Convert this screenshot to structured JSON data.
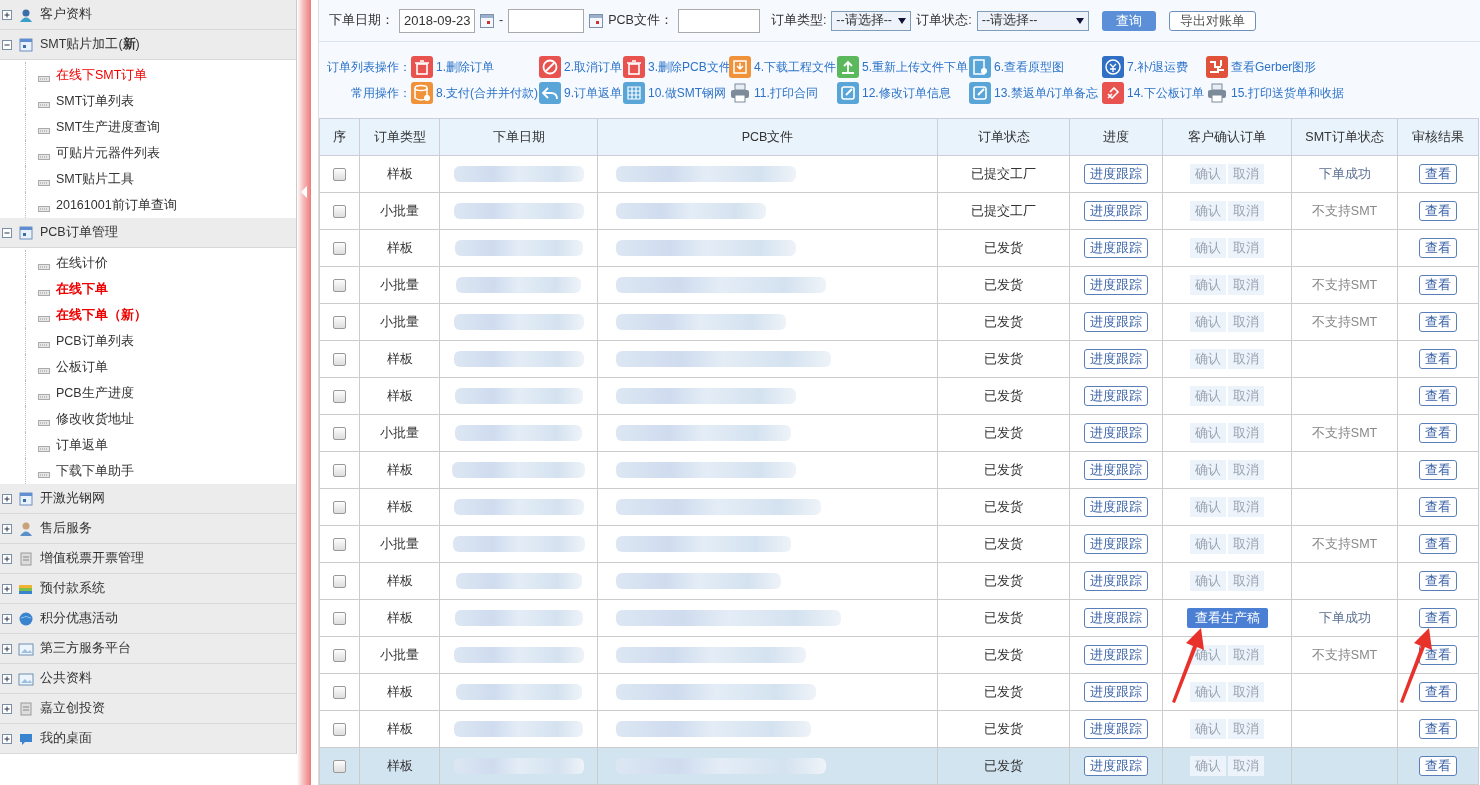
{
  "sidebar": {
    "groups": [
      {
        "title": "客户资料",
        "expanded": false
      },
      {
        "title": "SMT贴片加工(**新**)",
        "expanded": true,
        "children": [
          {
            "label": "在线下SMT订单",
            "highlighted": true,
            "bold": false
          },
          {
            "label": "SMT订单列表"
          },
          {
            "label": "SMT生产进度查询"
          },
          {
            "label": "可贴片元器件列表"
          },
          {
            "label": "SMT贴片工具"
          },
          {
            "label": "20161001前订单查询"
          }
        ]
      },
      {
        "title": "PCB订单管理",
        "expanded": true,
        "children": [
          {
            "label": "在线计价"
          },
          {
            "label": "在线下单",
            "highlighted": true,
            "bold": true
          },
          {
            "label": "在线下单（新）",
            "highlighted": true,
            "bold": true
          },
          {
            "label": "PCB订单列表"
          },
          {
            "label": "公板订单"
          },
          {
            "label": "PCB生产进度"
          },
          {
            "label": "修改收货地址"
          },
          {
            "label": "订单返单"
          },
          {
            "label": "下载下单助手"
          }
        ]
      },
      {
        "title": "开激光钢网",
        "expanded": false
      },
      {
        "title": "售后服务",
        "expanded": false
      },
      {
        "title": "增值税票开票管理",
        "expanded": false
      },
      {
        "title": "预付款系统",
        "expanded": false
      },
      {
        "title": "积分优惠活动",
        "expanded": false
      },
      {
        "title": "第三方服务平台",
        "expanded": false
      },
      {
        "title": "公共资料",
        "expanded": false
      },
      {
        "title": "嘉立创投资",
        "expanded": false
      },
      {
        "title": "我的桌面",
        "expanded": false
      }
    ]
  },
  "filters": {
    "date_label": "下单日期：",
    "date_from": "2018-09-23",
    "date_sep": "-",
    "pcb_label": "PCB文件：",
    "type_label": "订单类型:",
    "type_value": "--请选择--",
    "status_label": "订单状态:",
    "status_value": "--请选择--",
    "query_button": "查询",
    "export_button": "导出对账单"
  },
  "actions": [
    {
      "label": "订单列表操作：",
      "items": [
        {
          "text": "1.删除订单",
          "color": "#e8524f"
        },
        {
          "text": "2.取消订单",
          "color": "#e8524f"
        },
        {
          "text": "3.删除PCB文件",
          "color": "#e8524f"
        },
        {
          "text": "4.下载工程文件",
          "color": "#f0923a"
        },
        {
          "text": "5.重新上传文件下单",
          "color": "#5cb85c"
        },
        {
          "text": "6.查看原型图",
          "color": "#5aa5d8"
        },
        {
          "text": "7.补/退运费",
          "color": "#2f6fc4"
        },
        {
          "text": "查看Gerber图形",
          "color": "#e0533a"
        }
      ]
    },
    {
      "label": "常用操作：",
      "items": [
        {
          "text": "8.支付(合并并付款)",
          "color": "#f0923a"
        },
        {
          "text": "9.订单返单",
          "color": "#5aa5d8"
        },
        {
          "text": "10.做SMT钢网",
          "color": "#5aa5d8"
        },
        {
          "text": "11.打印合同",
          "color": "#7c8a99"
        },
        {
          "text": "12.修改订单信息",
          "color": "#5aa5d8"
        },
        {
          "text": "13.禁返单/订单备忘",
          "color": "#5aa5d8"
        },
        {
          "text": "14.下公板订单",
          "color": "#e8524f"
        },
        {
          "text": "15.打印送货单和收据",
          "color": "#7c8a99"
        }
      ]
    }
  ],
  "table": {
    "columns": [
      "序",
      "订单类型",
      "下单日期",
      "PCB文件",
      "订单状态",
      "进度",
      "客户确认订单",
      "SMT订单状态",
      "审核结果"
    ],
    "annotations": [
      {
        "kind": "arrow"
      },
      {
        "kind": "arrow"
      }
    ],
    "rows": [
      {
        "checked": false,
        "selected": false,
        "type": "样板",
        "status": "已提交工厂",
        "progress": "进度跟踪",
        "confirm": {
          "kind": "pair",
          "ok": "确认",
          "cancel": "取消"
        },
        "smt": "下单成功",
        "smt_success": true,
        "result": "查看"
      },
      {
        "checked": false,
        "selected": false,
        "type": "小批量",
        "status": "已提交工厂",
        "progress": "进度跟踪",
        "confirm": {
          "kind": "pair",
          "ok": "确认",
          "cancel": "取消"
        },
        "smt": "不支持SMT",
        "smt_success": false,
        "result": "查看"
      },
      {
        "checked": false,
        "selected": false,
        "type": "样板",
        "status": "已发货",
        "progress": "进度跟踪",
        "confirm": {
          "kind": "pair",
          "ok": "确认",
          "cancel": "取消"
        },
        "result": "查看"
      },
      {
        "checked": false,
        "selected": false,
        "type": "小批量",
        "status": "已发货",
        "progress": "进度跟踪",
        "confirm": {
          "kind": "pair",
          "ok": "确认",
          "cancel": "取消"
        },
        "smt": "不支持SMT",
        "smt_success": false,
        "result": "查看"
      },
      {
        "checked": false,
        "selected": false,
        "type": "小批量",
        "status": "已发货",
        "progress": "进度跟踪",
        "confirm": {
          "kind": "pair",
          "ok": "确认",
          "cancel": "取消"
        },
        "smt": "不支持SMT",
        "smt_success": false,
        "result": "查看"
      },
      {
        "checked": false,
        "selected": false,
        "type": "样板",
        "status": "已发货",
        "progress": "进度跟踪",
        "confirm": {
          "kind": "pair",
          "ok": "确认",
          "cancel": "取消"
        },
        "result": "查看"
      },
      {
        "checked": false,
        "selected": false,
        "type": "样板",
        "status": "已发货",
        "progress": "进度跟踪",
        "confirm": {
          "kind": "pair",
          "ok": "确认",
          "cancel": "取消"
        },
        "result": "查看"
      },
      {
        "checked": false,
        "selected": false,
        "type": "小批量",
        "status": "已发货",
        "progress": "进度跟踪",
        "confirm": {
          "kind": "pair",
          "ok": "确认",
          "cancel": "取消"
        },
        "smt": "不支持SMT",
        "smt_success": false,
        "result": "查看"
      },
      {
        "checked": false,
        "selected": false,
        "type": "样板",
        "status": "已发货",
        "progress": "进度跟踪",
        "confirm": {
          "kind": "pair",
          "ok": "确认",
          "cancel": "取消"
        },
        "result": "查看"
      },
      {
        "checked": false,
        "selected": false,
        "type": "样板",
        "status": "已发货",
        "progress": "进度跟踪",
        "confirm": {
          "kind": "pair",
          "ok": "确认",
          "cancel": "取消"
        },
        "result": "查看"
      },
      {
        "checked": false,
        "selected": false,
        "type": "小批量",
        "status": "已发货",
        "progress": "进度跟踪",
        "confirm": {
          "kind": "pair",
          "ok": "确认",
          "cancel": "取消"
        },
        "smt": "不支持SMT",
        "smt_success": false,
        "result": "查看"
      },
      {
        "checked": false,
        "selected": false,
        "type": "样板",
        "status": "已发货",
        "progress": "进度跟踪",
        "confirm": {
          "kind": "pair",
          "ok": "确认",
          "cancel": "取消"
        },
        "result": "查看"
      },
      {
        "checked": false,
        "selected": false,
        "type": "样板",
        "status": "已发货",
        "progress": "进度跟踪",
        "confirm": {
          "kind": "view",
          "text": "查看生产稿"
        },
        "smt": "下单成功",
        "smt_success": true,
        "result": "查看"
      },
      {
        "checked": false,
        "selected": false,
        "type": "小批量",
        "status": "已发货",
        "progress": "进度跟踪",
        "confirm": {
          "kind": "pair",
          "ok": "确认",
          "cancel": "取消"
        },
        "smt": "不支持SMT",
        "smt_success": false,
        "result": "查看"
      },
      {
        "checked": false,
        "selected": false,
        "type": "样板",
        "status": "已发货",
        "progress": "进度跟踪",
        "confirm": {
          "kind": "pair",
          "ok": "确认",
          "cancel": "取消"
        },
        "result": "查看"
      },
      {
        "checked": false,
        "selected": false,
        "type": "样板",
        "status": "已发货",
        "progress": "进度跟踪",
        "confirm": {
          "kind": "pair",
          "ok": "确认",
          "cancel": "取消"
        },
        "result": "查看"
      },
      {
        "checked": false,
        "selected": true,
        "type": "样板",
        "status": "已发货",
        "progress": "进度跟踪",
        "confirm": {
          "kind": "pair",
          "ok": "确认",
          "cancel": "取消"
        },
        "result": "查看"
      }
    ]
  }
}
